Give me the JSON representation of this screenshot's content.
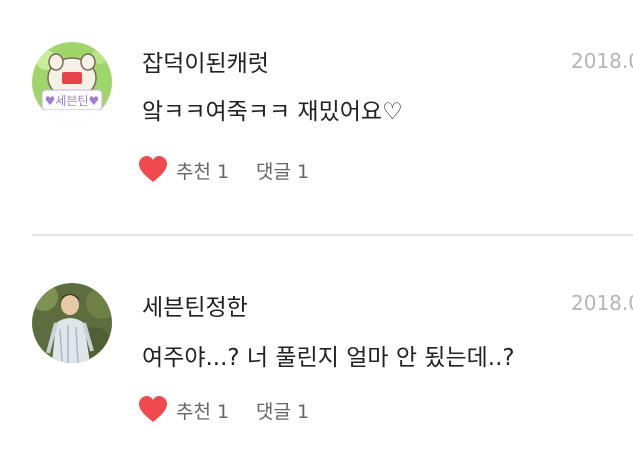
{
  "comments": [
    {
      "author": "잡덕이된캐럿",
      "date": "2018.0",
      "text": "앜ㅋㅋ여죽ㅋㅋ 재밌어요♡",
      "likes_label": "추천 1",
      "replies_label": "댓글 1",
      "avatar_badge": "♥세븐틴♥"
    },
    {
      "author": "세븐틴정한",
      "date": "2018.0",
      "text": "여주야...? 너 풀린지 얼마 안 됬는데..?",
      "likes_label": "추천 1",
      "replies_label": "댓글 1"
    }
  ],
  "colors": {
    "heart": "#f2494f",
    "date": "#b5b5b5",
    "divider": "#e6e6e6"
  }
}
